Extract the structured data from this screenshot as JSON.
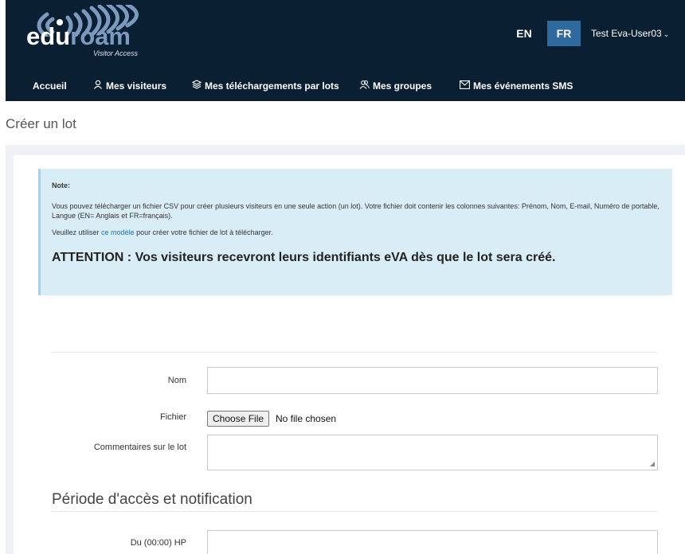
{
  "brand": {
    "name_part1": "edu",
    "name_part2": "roam",
    "subtitle": "Visitor Access",
    "color": "#0b1f33"
  },
  "header": {
    "languages": [
      {
        "label": "EN",
        "active": false
      },
      {
        "label": "FR",
        "active": true
      }
    ],
    "user": "Test Eva-User03",
    "user_caret": "⌄"
  },
  "nav": {
    "items": [
      {
        "label": "Accueil",
        "icon": ""
      },
      {
        "label": "Mes visiteurs",
        "icon": "user-icon"
      },
      {
        "label": "Mes téléchargements par lots",
        "icon": "layers-icon"
      },
      {
        "label": "Mes groupes",
        "icon": "users-icon"
      },
      {
        "label": "Mes événements SMS",
        "icon": "envelope-icon"
      }
    ]
  },
  "page": {
    "title": "Créer un lot"
  },
  "note": {
    "title": "Note:",
    "paragraph1": "Vous pouvez télécharger un fichier CSV pour créer plusieurs visiteurs en une seule action (un lot). Votre fichier doit contenir les colonnes suivantes: Prénom, Nom, E-mail, Numéro de portable, Langue (EN= Anglais et FR=français).",
    "paragraph2_before": "Veuillez utiliser ",
    "paragraph2_link": "ce modèle",
    "paragraph2_after": " pour créer votre fichier de lot à télécharger.",
    "warning": "ATTENTION : Vos visiteurs recevront leurs identifiants eVA dès que le lot sera créé."
  },
  "form": {
    "name_label": "Nom",
    "name_value": "",
    "file_label": "Fichier",
    "file_button": "Choose File",
    "file_status": "No file chosen",
    "comments_label": "Commentaires sur le lot",
    "comments_value": ""
  },
  "access": {
    "section_title": "Période d'accès et notification",
    "from_label": "Du (00:00) HP",
    "from_value": ""
  }
}
